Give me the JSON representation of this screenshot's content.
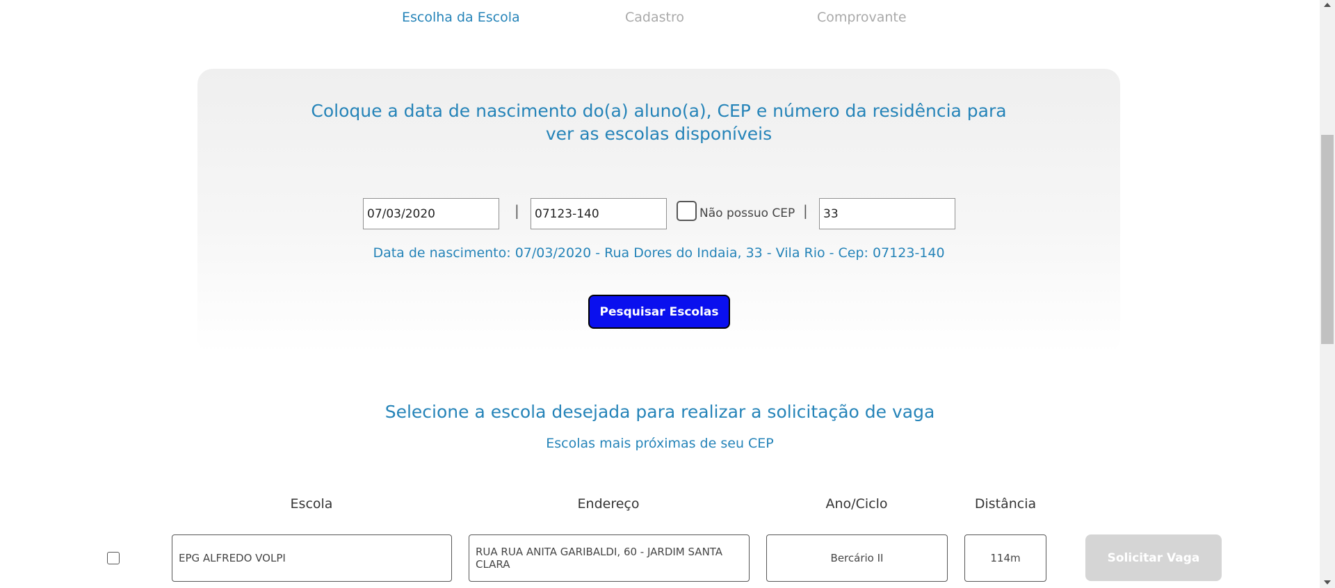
{
  "steps": {
    "step1": "Escolha da Escola",
    "step2": "Cadastro",
    "step3": "Comprovante"
  },
  "search": {
    "title": "Coloque a data de nascimento do(a) aluno(a), CEP e número da residência para ver as escolas disponíveis",
    "birth_date": "07/03/2020",
    "cep": "07123-140",
    "no_cep_label": "Não possuo CEP",
    "no_cep_checked": false,
    "house_number": "33",
    "separator": "|",
    "summary": "Data de nascimento: 07/03/2020 - Rua Dores do Indaia, 33 - Vila Rio - Cep: 07123-140",
    "button_label": "Pesquisar Escolas"
  },
  "results": {
    "title": "Selecione a escola desejada para realizar a solicitação de vaga",
    "subtitle": "Escolas mais próximas de seu CEP",
    "columns": {
      "school": "Escola",
      "address": "Endereço",
      "grade": "Ano/Ciclo",
      "distance": "Distância"
    },
    "rows": [
      {
        "school": "EPG ALFREDO VOLPI",
        "address": "RUA RUA ANITA GARIBALDI, 60 - JARDIM SANTA CLARA",
        "grade": "Bercário II",
        "distance": "114m",
        "button_label": "Solicitar Vaga",
        "selected": false
      }
    ]
  },
  "colors": {
    "accent": "#2483b8",
    "inactive_step": "#a9a9a9",
    "primary_button": "#0a10ee",
    "disabled_button": "#d5d5d5"
  }
}
